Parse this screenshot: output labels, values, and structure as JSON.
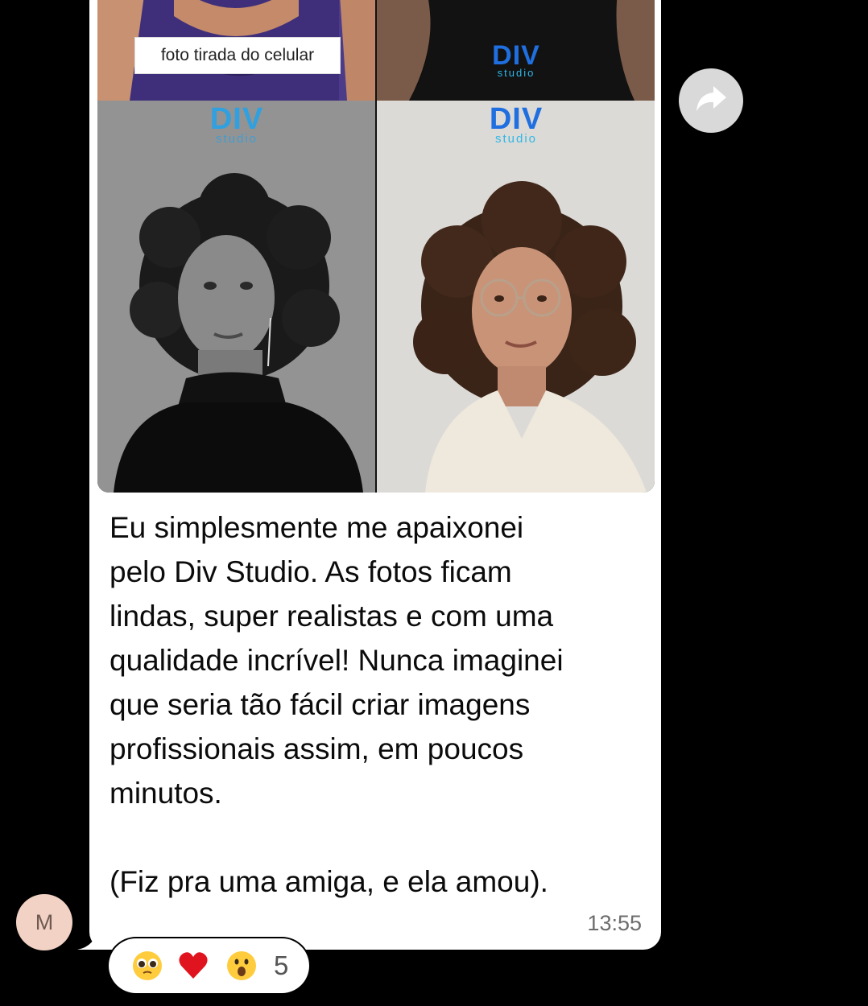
{
  "message": {
    "photo_caption": "foto tirada do celular",
    "logo": {
      "main": "DIV",
      "sub": "studio"
    },
    "text": "Eu simplesmente me apaixonei\npelo Div Studio. As fotos ficam\nlindas, super realistas e com uma\nqualidade incrível! Nunca imaginei\nque seria tão fácil criar imagens\nprofissionais assim, em poucos\nminutos.\n\n(Fiz pra uma amiga, e ela amou).",
    "time": "13:55"
  },
  "sender": {
    "avatar_initial": "M"
  },
  "reactions": {
    "emojis": [
      "pleading-face-icon",
      "red-heart-icon",
      "surprised-face-icon"
    ],
    "count": "5"
  },
  "colors": {
    "bubble": "#ffffff",
    "background": "#000000",
    "logo_blue": "#1f6fe0",
    "logo_cyan": "#2fb7e8",
    "avatar_bg": "#f2d2c4",
    "share_bg": "#d9d9d9"
  }
}
